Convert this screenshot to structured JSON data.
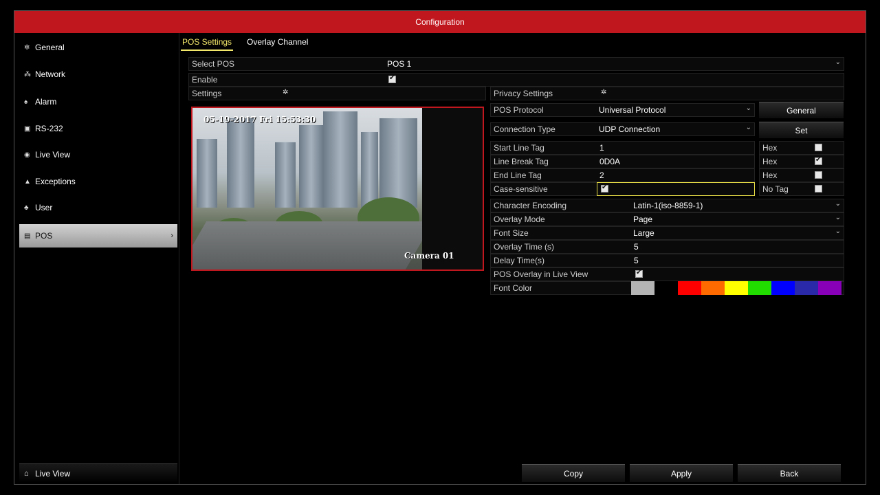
{
  "title": "Configuration",
  "sidebar": {
    "items": [
      {
        "label": "General",
        "icon": "gear-icon"
      },
      {
        "label": "Network",
        "icon": "network-icon"
      },
      {
        "label": "Alarm",
        "icon": "alarm-icon"
      },
      {
        "label": "RS-232",
        "icon": "rs232-icon"
      },
      {
        "label": "Live View",
        "icon": "eye-icon"
      },
      {
        "label": "Exceptions",
        "icon": "warning-icon"
      },
      {
        "label": "User",
        "icon": "user-icon"
      },
      {
        "label": "POS",
        "icon": "pos-icon"
      }
    ],
    "bottom": "Live View"
  },
  "tabs": [
    "POS Settings",
    "Overlay Channel"
  ],
  "select_pos": {
    "label": "Select POS",
    "value": "POS 1"
  },
  "enable": {
    "label": "Enable",
    "checked": true
  },
  "settings_label": "Settings",
  "privacy_label": "Privacy Settings",
  "preview": {
    "timestamp": "05-19-2017 Fri 15:53:30",
    "camera": "Camera 01"
  },
  "pos_protocol": {
    "label": "POS Protocol",
    "value": "Universal Protocol",
    "button": "General"
  },
  "connection_type": {
    "label": "Connection Type",
    "value": "UDP Connection",
    "button": "Set"
  },
  "start_line_tag": {
    "label": "Start Line Tag",
    "value": "1",
    "suffix": "Hex",
    "checked": false
  },
  "line_break_tag": {
    "label": "Line Break Tag",
    "value": "0D0A",
    "suffix": "Hex",
    "checked": true
  },
  "end_line_tag": {
    "label": "End Line Tag",
    "value": "2",
    "suffix": "Hex",
    "checked": false
  },
  "case_sensitive": {
    "label": "Case-sensitive",
    "checked": true,
    "suffix": "No Tag",
    "no_tag_checked": false
  },
  "character_encoding": {
    "label": "Character Encoding",
    "value": "Latin-1(iso-8859-1)"
  },
  "overlay_mode": {
    "label": "Overlay Mode",
    "value": "Page"
  },
  "font_size": {
    "label": "Font Size",
    "value": "Large"
  },
  "overlay_time": {
    "label": "Overlay Time (s)",
    "value": "5"
  },
  "delay_time": {
    "label": "Delay Time(s)",
    "value": "5"
  },
  "pos_overlay_live": {
    "label": "POS Overlay in Live View",
    "checked": true
  },
  "font_color": {
    "label": "Font Color",
    "colors": [
      "#b4b4b4",
      "#000000",
      "#ff0000",
      "#ff6a00",
      "#ffff00",
      "#22dd00",
      "#0000ff",
      "#2a2aa8",
      "#8800b8"
    ]
  },
  "buttons": {
    "copy": "Copy",
    "apply": "Apply",
    "back": "Back"
  }
}
